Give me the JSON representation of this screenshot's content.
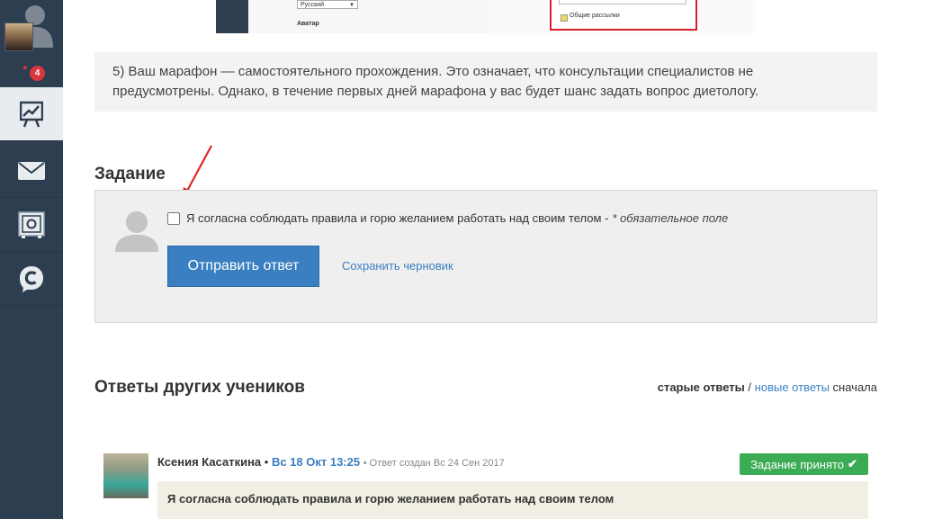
{
  "sidebar": {
    "notification_count": "4",
    "items": [
      {
        "name": "stats-icon",
        "active": true
      },
      {
        "name": "mail-icon",
        "active": false
      },
      {
        "name": "safe-icon",
        "active": false
      },
      {
        "name": "chat-icon",
        "active": false
      }
    ]
  },
  "embedded_screenshot": {
    "language_select": "Русский",
    "avatar_label": "Аватар",
    "newsletter_label": "Общие рассылки"
  },
  "info": {
    "text": "5) Ваш марафон — самостоятельного прохождения. Это означает, что консультации специалистов не предусмотрены. Однако, в течение первых дней марафона у вас будет шанс задать вопрос диетологу."
  },
  "task": {
    "heading": "Задание",
    "consent_label": "Я согласна соблюдать правила и горю желанием работать над своим телом -",
    "required_note": "* обязательное поле",
    "submit_label": "Отправить ответ",
    "draft_label": "Сохранить черновик"
  },
  "answers": {
    "heading": "Ответы других учеников",
    "sort_old": "старые ответы",
    "sort_separator": "/",
    "sort_new": "новые ответы",
    "sort_suffix": "сначала",
    "items": [
      {
        "author": "Ксения Касаткина",
        "date": "Вс 18 Окт 13:25",
        "created": "Ответ создан Вс 24 Сен 2017",
        "status": "Задание принято",
        "text": "Я согласна соблюдать правила и горю желанием работать над своим телом"
      }
    ]
  },
  "colors": {
    "sidebar": "#2d3e50",
    "accent": "#3a7fc1",
    "success": "#3bab54",
    "alert": "#d9363e"
  }
}
